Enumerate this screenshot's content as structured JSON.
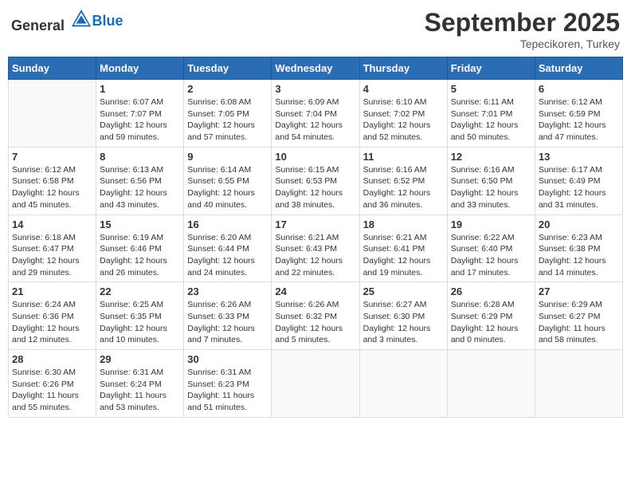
{
  "header": {
    "logo_general": "General",
    "logo_blue": "Blue",
    "month_year": "September 2025",
    "location": "Tepecikoren, Turkey"
  },
  "days_of_week": [
    "Sunday",
    "Monday",
    "Tuesday",
    "Wednesday",
    "Thursday",
    "Friday",
    "Saturday"
  ],
  "weeks": [
    [
      {
        "day": "",
        "info": ""
      },
      {
        "day": "1",
        "info": "Sunrise: 6:07 AM\nSunset: 7:07 PM\nDaylight: 12 hours\nand 59 minutes."
      },
      {
        "day": "2",
        "info": "Sunrise: 6:08 AM\nSunset: 7:05 PM\nDaylight: 12 hours\nand 57 minutes."
      },
      {
        "day": "3",
        "info": "Sunrise: 6:09 AM\nSunset: 7:04 PM\nDaylight: 12 hours\nand 54 minutes."
      },
      {
        "day": "4",
        "info": "Sunrise: 6:10 AM\nSunset: 7:02 PM\nDaylight: 12 hours\nand 52 minutes."
      },
      {
        "day": "5",
        "info": "Sunrise: 6:11 AM\nSunset: 7:01 PM\nDaylight: 12 hours\nand 50 minutes."
      },
      {
        "day": "6",
        "info": "Sunrise: 6:12 AM\nSunset: 6:59 PM\nDaylight: 12 hours\nand 47 minutes."
      }
    ],
    [
      {
        "day": "7",
        "info": "Sunrise: 6:12 AM\nSunset: 6:58 PM\nDaylight: 12 hours\nand 45 minutes."
      },
      {
        "day": "8",
        "info": "Sunrise: 6:13 AM\nSunset: 6:56 PM\nDaylight: 12 hours\nand 43 minutes."
      },
      {
        "day": "9",
        "info": "Sunrise: 6:14 AM\nSunset: 6:55 PM\nDaylight: 12 hours\nand 40 minutes."
      },
      {
        "day": "10",
        "info": "Sunrise: 6:15 AM\nSunset: 6:53 PM\nDaylight: 12 hours\nand 38 minutes."
      },
      {
        "day": "11",
        "info": "Sunrise: 6:16 AM\nSunset: 6:52 PM\nDaylight: 12 hours\nand 36 minutes."
      },
      {
        "day": "12",
        "info": "Sunrise: 6:16 AM\nSunset: 6:50 PM\nDaylight: 12 hours\nand 33 minutes."
      },
      {
        "day": "13",
        "info": "Sunrise: 6:17 AM\nSunset: 6:49 PM\nDaylight: 12 hours\nand 31 minutes."
      }
    ],
    [
      {
        "day": "14",
        "info": "Sunrise: 6:18 AM\nSunset: 6:47 PM\nDaylight: 12 hours\nand 29 minutes."
      },
      {
        "day": "15",
        "info": "Sunrise: 6:19 AM\nSunset: 6:46 PM\nDaylight: 12 hours\nand 26 minutes."
      },
      {
        "day": "16",
        "info": "Sunrise: 6:20 AM\nSunset: 6:44 PM\nDaylight: 12 hours\nand 24 minutes."
      },
      {
        "day": "17",
        "info": "Sunrise: 6:21 AM\nSunset: 6:43 PM\nDaylight: 12 hours\nand 22 minutes."
      },
      {
        "day": "18",
        "info": "Sunrise: 6:21 AM\nSunset: 6:41 PM\nDaylight: 12 hours\nand 19 minutes."
      },
      {
        "day": "19",
        "info": "Sunrise: 6:22 AM\nSunset: 6:40 PM\nDaylight: 12 hours\nand 17 minutes."
      },
      {
        "day": "20",
        "info": "Sunrise: 6:23 AM\nSunset: 6:38 PM\nDaylight: 12 hours\nand 14 minutes."
      }
    ],
    [
      {
        "day": "21",
        "info": "Sunrise: 6:24 AM\nSunset: 6:36 PM\nDaylight: 12 hours\nand 12 minutes."
      },
      {
        "day": "22",
        "info": "Sunrise: 6:25 AM\nSunset: 6:35 PM\nDaylight: 12 hours\nand 10 minutes."
      },
      {
        "day": "23",
        "info": "Sunrise: 6:26 AM\nSunset: 6:33 PM\nDaylight: 12 hours\nand 7 minutes."
      },
      {
        "day": "24",
        "info": "Sunrise: 6:26 AM\nSunset: 6:32 PM\nDaylight: 12 hours\nand 5 minutes."
      },
      {
        "day": "25",
        "info": "Sunrise: 6:27 AM\nSunset: 6:30 PM\nDaylight: 12 hours\nand 3 minutes."
      },
      {
        "day": "26",
        "info": "Sunrise: 6:28 AM\nSunset: 6:29 PM\nDaylight: 12 hours\nand 0 minutes."
      },
      {
        "day": "27",
        "info": "Sunrise: 6:29 AM\nSunset: 6:27 PM\nDaylight: 11 hours\nand 58 minutes."
      }
    ],
    [
      {
        "day": "28",
        "info": "Sunrise: 6:30 AM\nSunset: 6:26 PM\nDaylight: 11 hours\nand 55 minutes."
      },
      {
        "day": "29",
        "info": "Sunrise: 6:31 AM\nSunset: 6:24 PM\nDaylight: 11 hours\nand 53 minutes."
      },
      {
        "day": "30",
        "info": "Sunrise: 6:31 AM\nSunset: 6:23 PM\nDaylight: 11 hours\nand 51 minutes."
      },
      {
        "day": "",
        "info": ""
      },
      {
        "day": "",
        "info": ""
      },
      {
        "day": "",
        "info": ""
      },
      {
        "day": "",
        "info": ""
      }
    ]
  ]
}
